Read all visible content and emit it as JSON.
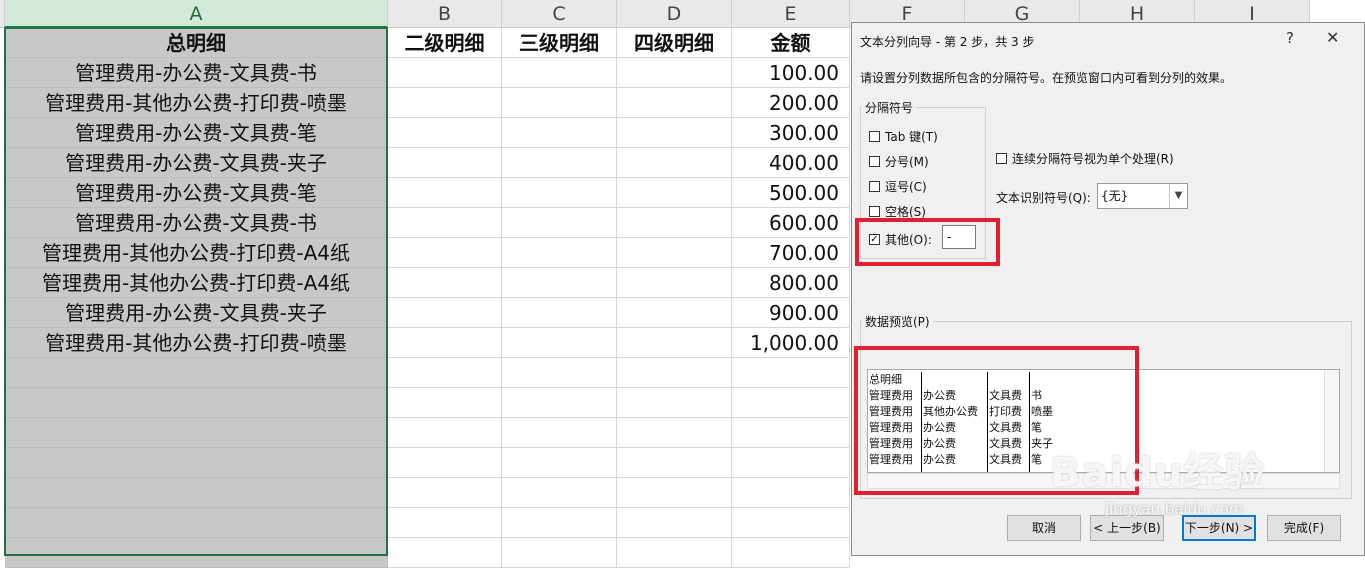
{
  "columns": {
    "A": "A",
    "B": "B",
    "C": "C",
    "D": "D",
    "E": "E",
    "F": "F",
    "G": "G",
    "H": "H",
    "I": "I"
  },
  "header_row": {
    "total": "总明细",
    "level2": "二级明细",
    "level3": "三级明细",
    "level4": "四级明细",
    "amount": "金额"
  },
  "rows": [
    {
      "detail": "管理费用-办公费-文具费-书",
      "amount": "100.00"
    },
    {
      "detail": "管理费用-其他办公费-打印费-喷墨",
      "amount": "200.00"
    },
    {
      "detail": "管理费用-办公费-文具费-笔",
      "amount": "300.00"
    },
    {
      "detail": "管理费用-办公费-文具费-夹子",
      "amount": "400.00"
    },
    {
      "detail": "管理费用-办公费-文具费-笔",
      "amount": "500.00"
    },
    {
      "detail": "管理费用-办公费-文具费-书",
      "amount": "600.00"
    },
    {
      "detail": "管理费用-其他办公费-打印费-A4纸",
      "amount": "700.00"
    },
    {
      "detail": "管理费用-其他办公费-打印费-A4纸",
      "amount": "800.00"
    },
    {
      "detail": "管理费用-办公费-文具费-夹子",
      "amount": "900.00"
    },
    {
      "detail": "管理费用-其他办公费-打印费-喷墨",
      "amount": "1,000.00"
    }
  ],
  "dialog": {
    "title": "文本分列向导 - 第 2 步，共 3 步",
    "help": "?",
    "close": "✕",
    "description": "请设置分列数据所包含的分隔符号。在预览窗口内可看到分列的效果。",
    "delimiters_label": "分隔符号",
    "tab": "Tab 键(T)",
    "semicolon": "分号(M)",
    "comma": "逗号(C)",
    "space": "空格(S)",
    "other": "其他(O):",
    "other_value": "-",
    "consecutive": "连续分隔符号视为单个处理(R)",
    "qualifier_label": "文本识别符号(Q):",
    "qualifier_value": "{无}",
    "preview_label": "数据预览(P)",
    "preview_rows": [
      [
        "总明细",
        "",
        "",
        ""
      ],
      [
        "管理费用",
        "办公费",
        "文具费",
        "书"
      ],
      [
        "管理费用",
        "其他办公费",
        "打印费",
        "喷墨"
      ],
      [
        "管理费用",
        "办公费",
        "文具费",
        "笔"
      ],
      [
        "管理费用",
        "办公费",
        "文具费",
        "夹子"
      ],
      [
        "管理费用",
        "办公费",
        "文具费",
        "笔"
      ]
    ],
    "buttons": {
      "cancel": "取消",
      "back": "< 上一步(B)",
      "next": "下一步(N) >",
      "finish": "完成(F)"
    }
  },
  "watermark": {
    "brand": "Baidu经验",
    "url": "jingyan.baidu.com"
  }
}
